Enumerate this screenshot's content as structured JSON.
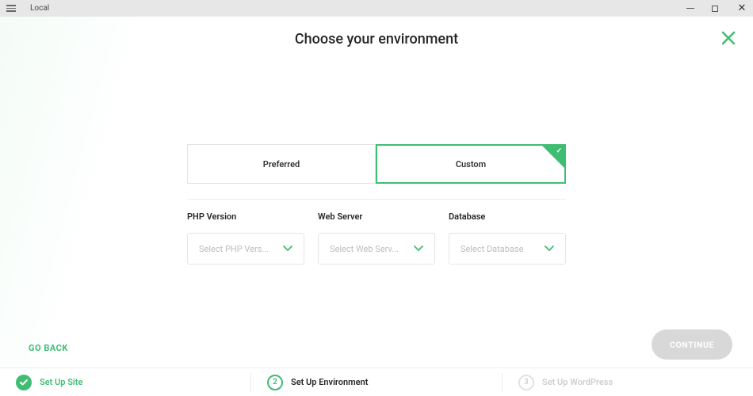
{
  "titlebar": {
    "app_name": "Local"
  },
  "header": {
    "title": "Choose your environment"
  },
  "segmented": {
    "preferred_label": "Preferred",
    "custom_label": "Custom",
    "selected": "custom"
  },
  "config": {
    "php": {
      "label": "PHP Version",
      "placeholder": "Select PHP Vers..."
    },
    "webserver": {
      "label": "Web Server",
      "placeholder": "Select Web Serv..."
    },
    "database": {
      "label": "Database",
      "placeholder": "Select Database"
    }
  },
  "actions": {
    "go_back": "GO BACK",
    "continue": "CONTINUE"
  },
  "stepper": {
    "steps": [
      {
        "num": "✓",
        "label": "Set Up Site",
        "state": "done"
      },
      {
        "num": "2",
        "label": "Set Up Environment",
        "state": "active"
      },
      {
        "num": "3",
        "label": "Set Up WordPress",
        "state": "pending"
      }
    ]
  },
  "colors": {
    "accent": "#3fbd73"
  }
}
